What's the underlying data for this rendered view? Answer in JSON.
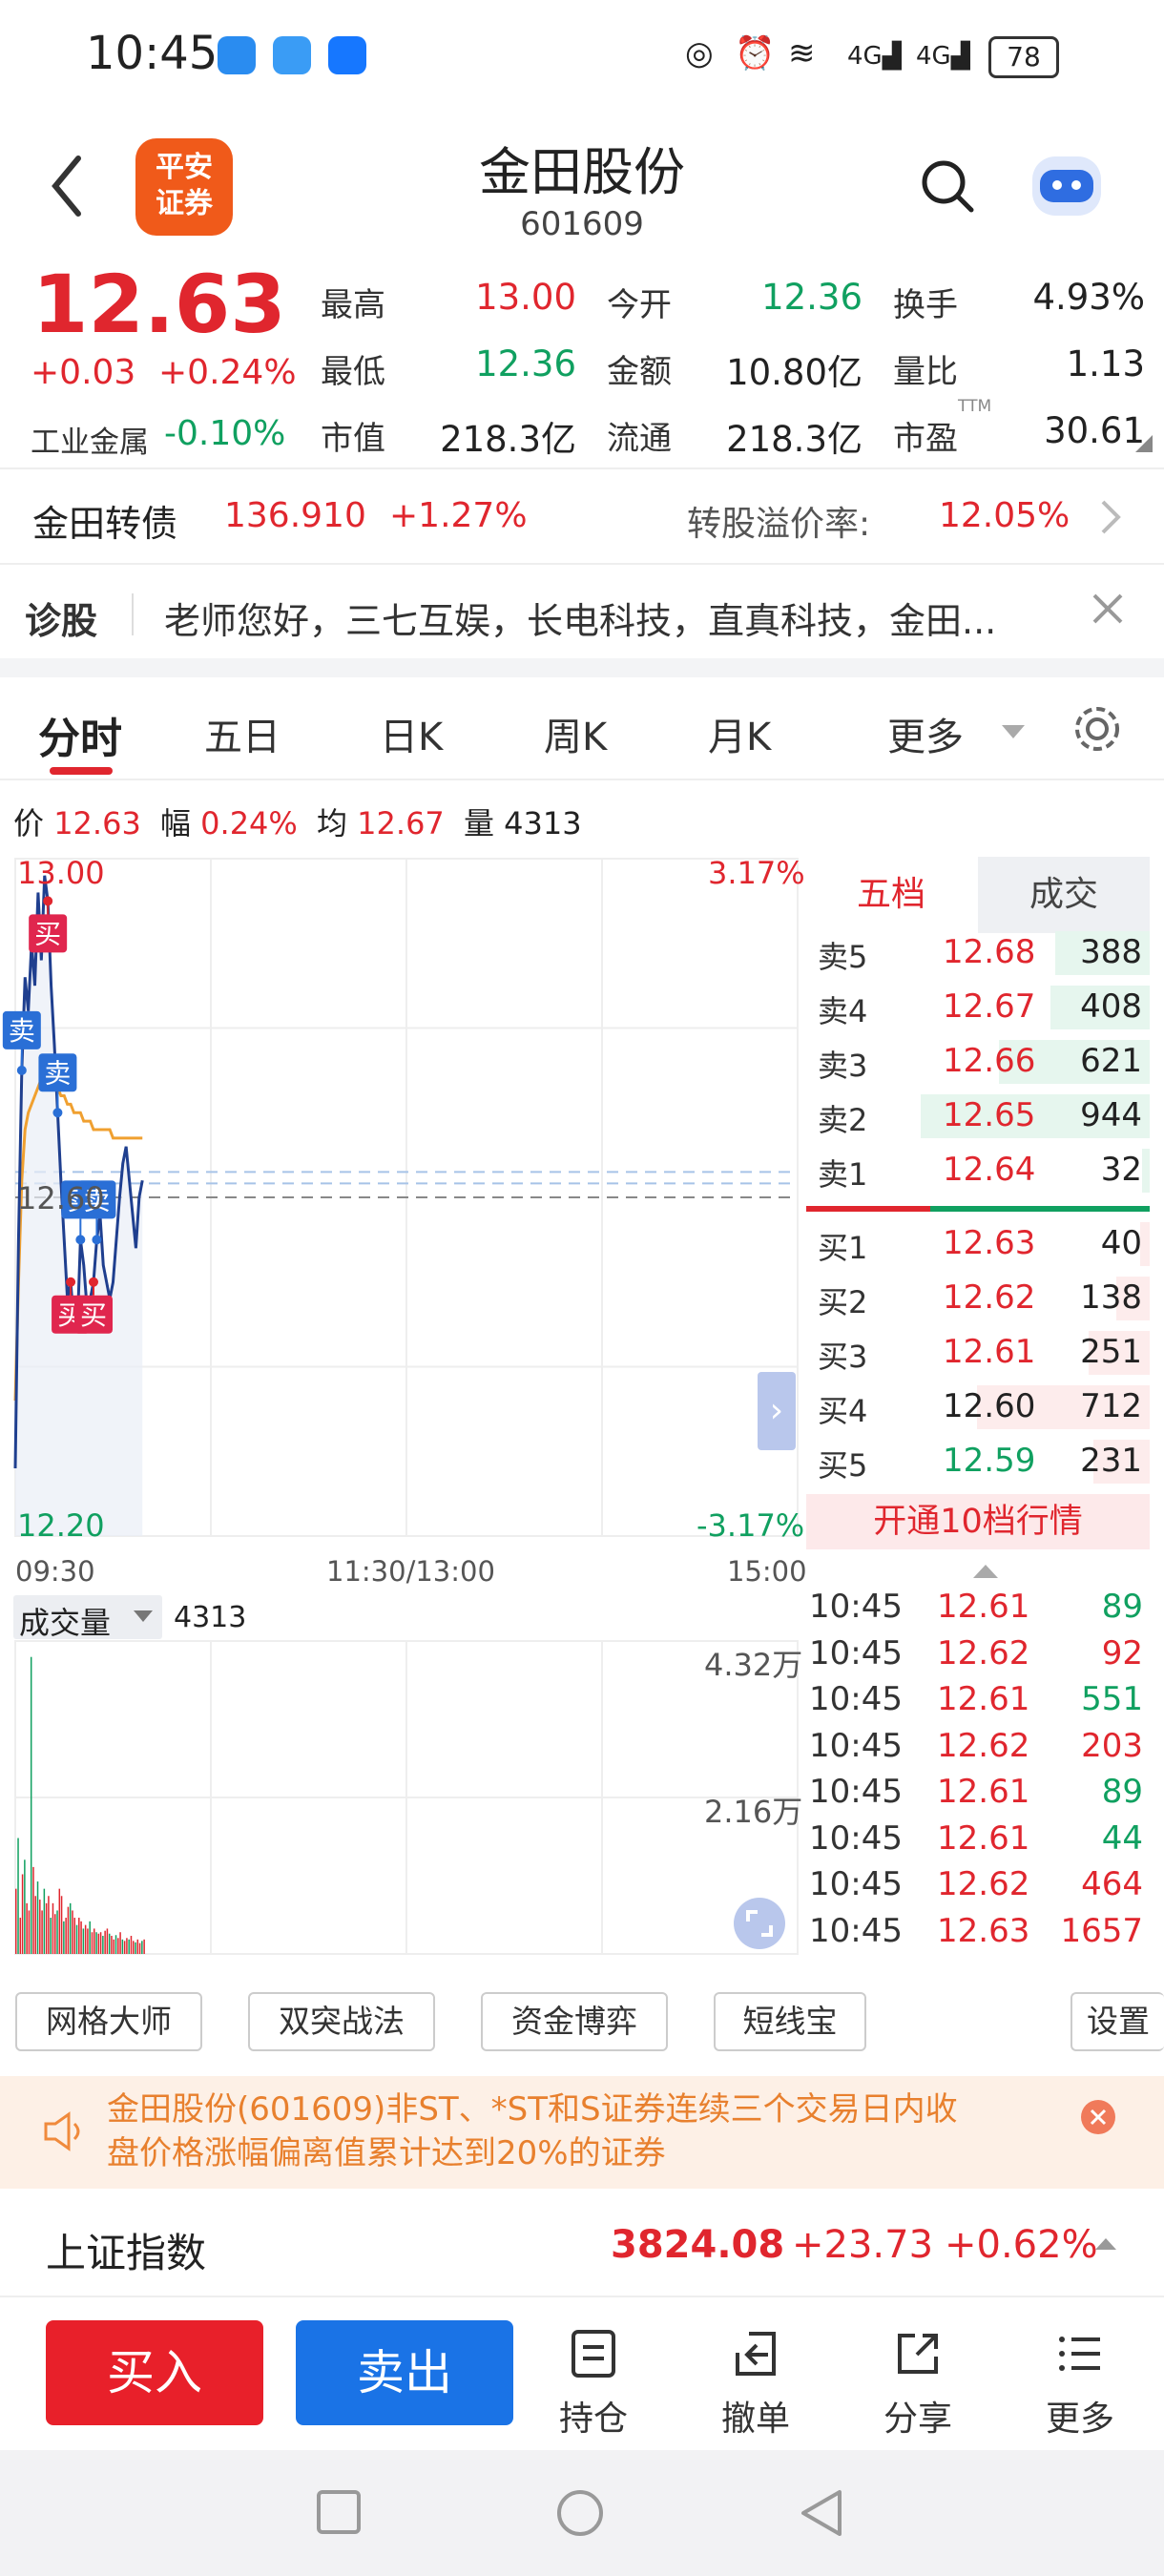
{
  "status_bar": {
    "time": "10:45",
    "battery": "78",
    "signal_icons": [
      "nfc-icon",
      "alarm-icon",
      "wifi-6-icon",
      "4g-signal-icon",
      "4g-signal-icon"
    ]
  },
  "header": {
    "logo_text_line1": "平安",
    "logo_text_line2": "证券",
    "title": "金田股份",
    "code": "601609"
  },
  "quote": {
    "price": "12.63",
    "change": "+0.03",
    "change_pct": "+0.24%",
    "sector_label": "工业金属",
    "sector_pct": "-0.10%",
    "grid": [
      {
        "label": "最高",
        "value": "13.00",
        "color": "red"
      },
      {
        "label": "今开",
        "value": "12.36",
        "color": "green"
      },
      {
        "label": "换手",
        "value": "4.93%",
        "color": "dark"
      },
      {
        "label": "最低",
        "value": "12.36",
        "color": "green"
      },
      {
        "label": "金额",
        "value": "10.80亿",
        "color": "dark"
      },
      {
        "label": "量比",
        "value": "1.13",
        "color": "dark"
      },
      {
        "label": "市值",
        "value": "218.3亿",
        "color": "dark"
      },
      {
        "label": "流通",
        "value": "218.3亿",
        "color": "dark"
      },
      {
        "label": "市盈",
        "value": "30.61",
        "color": "dark"
      }
    ],
    "pe_superscript": "TTM"
  },
  "bond": {
    "name": "金田转债",
    "price": "136.910",
    "pct": "+1.27%",
    "premium_label": "转股溢价率:",
    "premium_value": "12.05%"
  },
  "diagnose": {
    "label": "诊股",
    "text": "老师您好，三七互娱，长电科技，直真科技，金田..."
  },
  "tabs": [
    "分时",
    "五日",
    "日K",
    "周K",
    "月K",
    "更多"
  ],
  "chart_info": {
    "price_label": "价",
    "price": "12.63",
    "amp_label": "幅",
    "amp": "0.24%",
    "avg_label": "均",
    "avg": "12.67",
    "vol_label": "量",
    "vol": "4313"
  },
  "chart_data": {
    "type": "line",
    "title": "",
    "y_left_top": "13.00",
    "y_left_mid": "12.60",
    "y_left_bottom": "12.20",
    "y_right_top": "3.17%",
    "y_right_bottom": "-3.17%",
    "x_ticks": [
      "09:30",
      "11:30/13:00",
      "15:00"
    ],
    "ylim": [
      12.2,
      13.0
    ],
    "prev_close": 12.6,
    "minutes_total": 240,
    "series": [
      {
        "type": "price",
        "values": [
          12.28,
          12.55,
          12.75,
          12.86,
          12.82,
          12.9,
          12.85,
          12.96,
          12.88,
          12.98,
          12.95,
          12.85,
          12.78,
          12.7,
          12.62,
          12.55,
          12.48,
          12.5,
          12.45,
          12.44,
          12.55,
          12.52,
          12.47,
          12.48,
          12.5,
          12.55,
          12.58,
          12.52,
          12.5,
          12.48,
          12.5,
          12.55,
          12.6,
          12.64,
          12.66,
          12.62,
          12.58,
          12.54,
          12.6,
          12.62
        ]
      },
      {
        "type": "average",
        "values": [
          12.36,
          12.5,
          12.62,
          12.68,
          12.7,
          12.71,
          12.72,
          12.73,
          12.74,
          12.74,
          12.74,
          12.73,
          12.73,
          12.73,
          12.72,
          12.72,
          12.71,
          12.71,
          12.7,
          12.7,
          12.7,
          12.69,
          12.69,
          12.69,
          12.68,
          12.68,
          12.68,
          12.68,
          12.68,
          12.68,
          12.67,
          12.67,
          12.67,
          12.67,
          12.67,
          12.67,
          12.67,
          12.67,
          12.67,
          12.67
        ]
      }
    ],
    "trade_markers": [
      {
        "type": "卖",
        "minute": 2
      },
      {
        "type": "卖",
        "minute": 13
      },
      {
        "type": "买",
        "minute": 10
      },
      {
        "type": "买",
        "minute": 17
      },
      {
        "type": "卖",
        "minute": 20
      },
      {
        "type": "买",
        "minute": 24
      },
      {
        "type": "卖",
        "minute": 25
      }
    ],
    "volume_label": "成交量",
    "volume_value": "4313",
    "volume_axis_top": "4.32万",
    "volume_axis_mid": "2.16万",
    "volume_max": 43200,
    "volume_values": [
      9000,
      16000,
      5000,
      11000,
      13000,
      7000,
      6000,
      41000,
      12000,
      8000,
      10000,
      7500,
      6000,
      9000,
      7000,
      8000,
      5000,
      7000,
      5500,
      6000,
      9000,
      8000,
      4500,
      5000,
      6500,
      7000,
      6000,
      5000,
      4000,
      5000,
      4500,
      3500,
      4000,
      3500,
      4500,
      3000,
      3500,
      3000,
      2800,
      3000,
      2500,
      3200,
      3500,
      2800,
      2500,
      2000,
      2600,
      2200,
      3000,
      2000,
      1800,
      2200,
      2000,
      2500,
      1800,
      1600,
      2000,
      1500,
      1800,
      2000
    ]
  },
  "order_book": {
    "tab_active": "五档",
    "tab_other": "成交",
    "asks": [
      {
        "label": "卖5",
        "price": "12.68",
        "vol": "388"
      },
      {
        "label": "卖4",
        "price": "12.67",
        "vol": "408"
      },
      {
        "label": "卖3",
        "price": "12.66",
        "vol": "621"
      },
      {
        "label": "卖2",
        "price": "12.65",
        "vol": "944"
      },
      {
        "label": "卖1",
        "price": "12.64",
        "vol": "32"
      }
    ],
    "bids": [
      {
        "label": "买1",
        "price": "12.63",
        "vol": "40"
      },
      {
        "label": "买2",
        "price": "12.62",
        "vol": "138"
      },
      {
        "label": "买3",
        "price": "12.61",
        "vol": "251"
      },
      {
        "label": "买4",
        "price": "12.60",
        "vol": "712"
      },
      {
        "label": "买5",
        "price": "12.59",
        "vol": "231"
      }
    ],
    "upgrade_label": "开通10档行情"
  },
  "ticks": [
    {
      "time": "10:45",
      "price": "12.61",
      "vol": "89",
      "vcolor": "green"
    },
    {
      "time": "10:45",
      "price": "12.62",
      "vol": "92",
      "vcolor": "red"
    },
    {
      "time": "10:45",
      "price": "12.61",
      "vol": "551",
      "vcolor": "green"
    },
    {
      "time": "10:45",
      "price": "12.62",
      "vol": "203",
      "vcolor": "red"
    },
    {
      "time": "10:45",
      "price": "12.61",
      "vol": "89",
      "vcolor": "green"
    },
    {
      "time": "10:45",
      "price": "12.61",
      "vol": "44",
      "vcolor": "green"
    },
    {
      "time": "10:45",
      "price": "12.62",
      "vol": "464",
      "vcolor": "red"
    },
    {
      "time": "10:45",
      "price": "12.63",
      "vol": "1657",
      "vcolor": "red"
    }
  ],
  "tools": [
    "网格大师",
    "双突战法",
    "资金博弈",
    "短线宝",
    "设置"
  ],
  "notice": {
    "line1": "金田股份(601609)非ST、*ST和S证券连续三个交易日内收",
    "line2": "盘价格涨幅偏离值累计达到20%的证券"
  },
  "index": {
    "name": "上证指数",
    "value": "3824.08",
    "change": "+23.73",
    "pct": "+0.62%"
  },
  "bottom_bar": {
    "buy": "买入",
    "sell": "卖出",
    "hold": "持仓",
    "cancel": "撤单",
    "share": "分享",
    "more": "更多"
  },
  "colors": {
    "up": "#e0262e",
    "down": "#10a060",
    "accent": "#2a6fd6"
  }
}
